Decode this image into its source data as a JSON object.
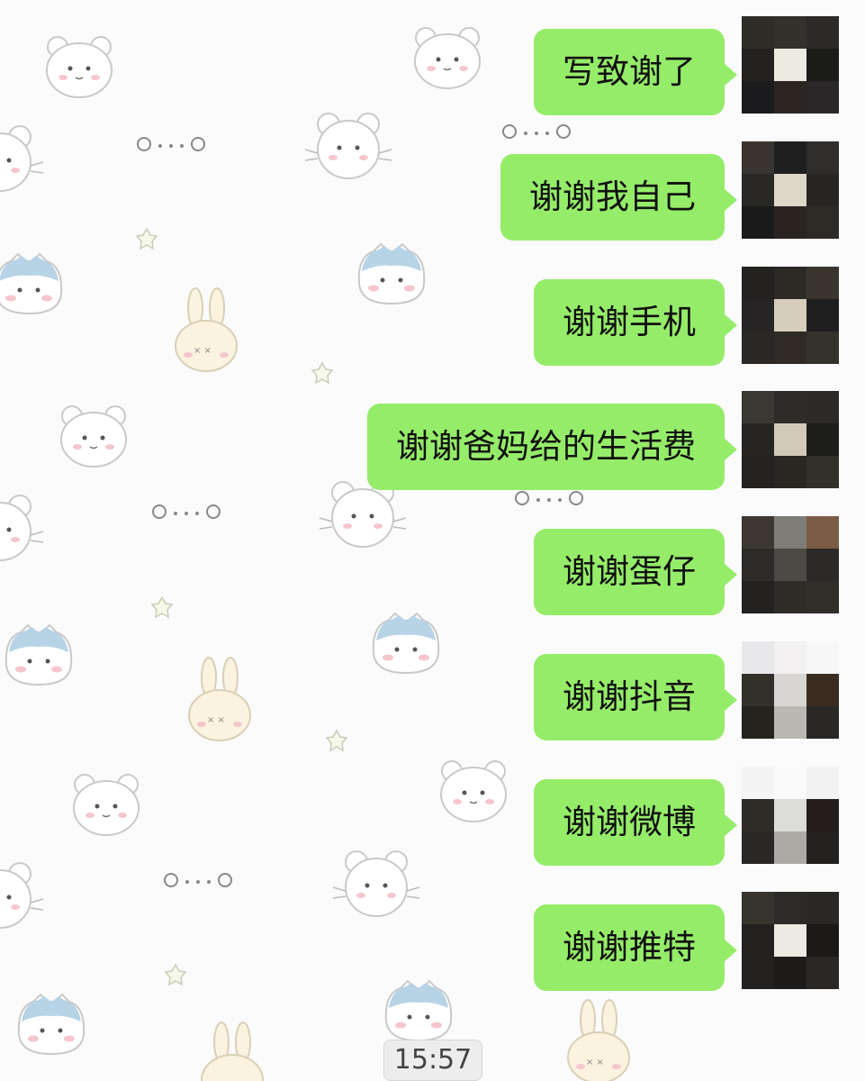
{
  "chat": {
    "messages": [
      {
        "text": "写致谢了",
        "sender": "self"
      },
      {
        "text": "谢谢我自己",
        "sender": "self"
      },
      {
        "text": "谢谢手机",
        "sender": "self"
      },
      {
        "text": "谢谢爸妈给的生活费",
        "sender": "self"
      },
      {
        "text": "谢谢蛋仔",
        "sender": "self"
      },
      {
        "text": "谢谢抖音",
        "sender": "self"
      },
      {
        "text": "谢谢微博",
        "sender": "self"
      },
      {
        "text": "谢谢推特",
        "sender": "self"
      }
    ],
    "timestamp": "15:57"
  },
  "theme": {
    "bubble_color": "#95ec69",
    "background_color": "#fbfbfc",
    "wallpaper": "cute-animal-doodle-pattern",
    "avatar_style": "pixelated-mosaic"
  }
}
